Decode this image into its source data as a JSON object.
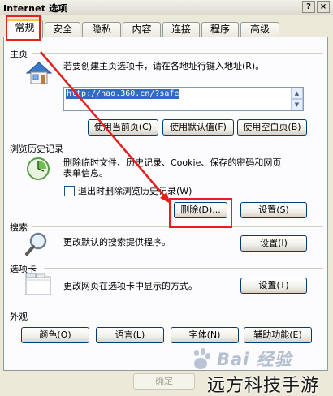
{
  "window": {
    "title": "Internet 选项",
    "help_label": "?",
    "close_label": "×"
  },
  "tabs": [
    {
      "label": "常规"
    },
    {
      "label": "安全"
    },
    {
      "label": "隐私"
    },
    {
      "label": "内容"
    },
    {
      "label": "连接"
    },
    {
      "label": "程序"
    },
    {
      "label": "高级"
    }
  ],
  "home_page": {
    "section_label": "主页",
    "description": "若要创建主页选项卡，请在各地址行键入地址(R)。",
    "url_value": "http://hao.360.cn/?safe",
    "buttons": {
      "use_current": "使用当前页(C)",
      "use_default": "使用默认值(F)",
      "use_blank": "使用空白页(B)"
    }
  },
  "history": {
    "section_label": "浏览历史记录",
    "description_line1": "删除临时文件、历史记录、Cookie、保存的密码和网页",
    "description_line2": "表单信息。",
    "checkbox_label": "退出时删除浏览历史记录(W)",
    "checkbox_checked": false,
    "buttons": {
      "delete": "删除(D)...",
      "settings": "设置(S)"
    }
  },
  "search": {
    "section_label": "搜索",
    "description": "更改默认的搜索提供程序。",
    "settings_label": "设置(I)"
  },
  "tabs_section": {
    "section_label": "选项卡",
    "description": "更改网页在选项卡中显示的方式。",
    "settings_label": "设置(T)"
  },
  "appearance": {
    "section_label": "外观",
    "buttons": {
      "colors": "颜色(O)",
      "languages": "语言(L)",
      "fonts": "字体(N)",
      "accessibility": "辅助功能(E)"
    }
  },
  "footer": {
    "ok_label": "确定"
  },
  "watermark": {
    "baidu_text": "Bai 经验",
    "brand_text": "远方科技手游"
  },
  "colors": {
    "annotation_red": "#e8201d",
    "tab_highlight": "#ffc83c",
    "url_selection": "#316ac5"
  }
}
